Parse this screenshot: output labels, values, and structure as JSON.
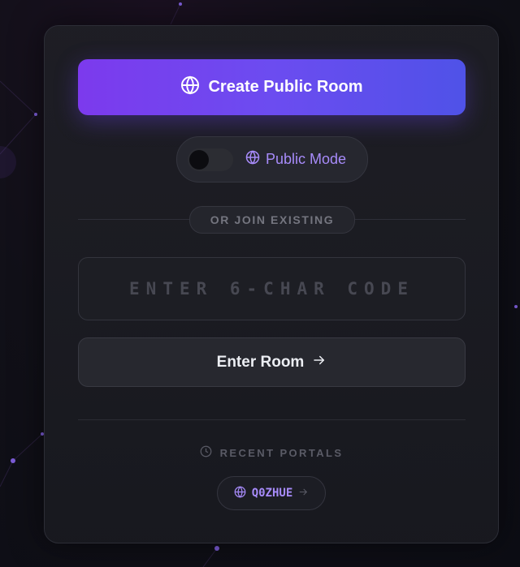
{
  "create_button": {
    "label": "Create Public Room",
    "icon": "globe-icon"
  },
  "mode_toggle": {
    "label": "Public Mode",
    "icon": "globe-icon",
    "enabled": false
  },
  "divider": {
    "label": "OR JOIN EXISTING"
  },
  "code_input": {
    "placeholder": "ENTER 6-CHAR CODE",
    "value": ""
  },
  "enter_button": {
    "label": "Enter Room",
    "icon": "arrow-right-icon"
  },
  "recent": {
    "heading": "RECENT PORTALS",
    "icon": "clock-icon",
    "items": [
      {
        "code": "Q0ZHUE",
        "icon": "globe-icon"
      }
    ]
  },
  "colors": {
    "accent": "#a78bfa",
    "gradient_start": "#7c3aed",
    "gradient_end": "#4f52e8"
  }
}
